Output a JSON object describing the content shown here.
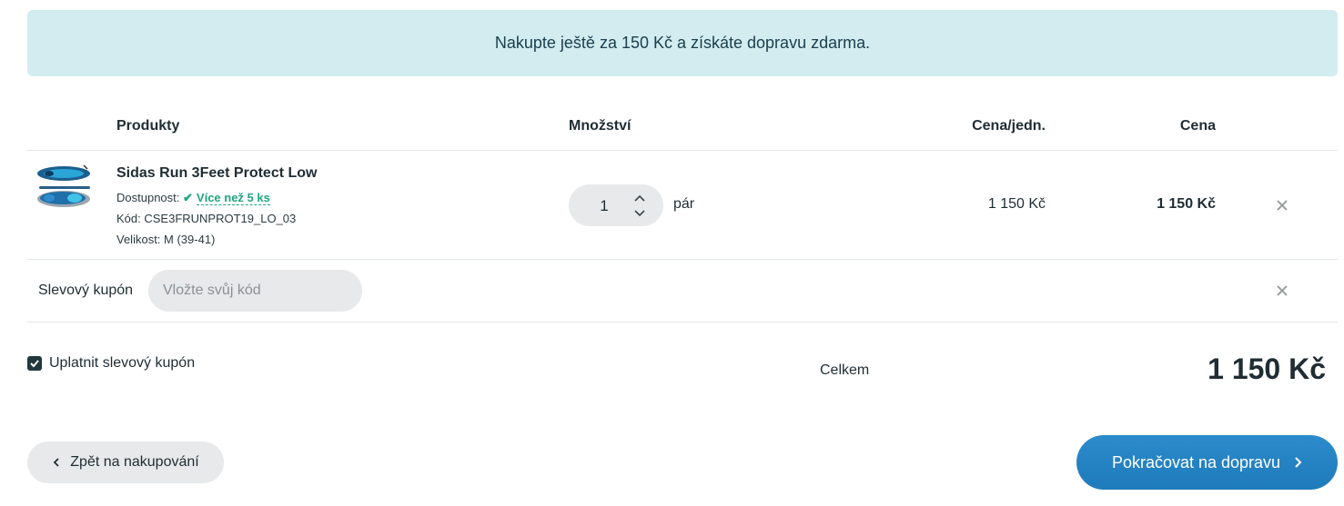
{
  "banner": {
    "text": "Nakupte ještě za 150 Kč a získáte dopravu zdarma."
  },
  "table": {
    "headers": {
      "products": "Produkty",
      "quantity": "Množství",
      "unit_price": "Cena/jedn.",
      "price": "Cena"
    },
    "rows": [
      {
        "name": "Sidas Run 3Feet Protect Low",
        "availability_label": "Dostupnost:",
        "availability_value": "Více než 5 ks",
        "code": "Kód: CSE3FRUNPROT19_LO_03",
        "size": "Velikost: M (39-41)",
        "quantity": "1",
        "unit": "pár",
        "unit_price": "1 150 Kč",
        "price": "1 150 Kč",
        "thumbnail_icon": "insole-thumbnail"
      }
    ]
  },
  "coupon": {
    "label": "Slevový kupón",
    "placeholder": "Vložte svůj kód",
    "apply_label": "Uplatnit slevový kupón",
    "apply_checked": true
  },
  "summary": {
    "total_label": "Celkem",
    "total_value": "1 150 Kč"
  },
  "actions": {
    "back_label": "Zpět na nakupování",
    "continue_label": "Pokračovat na dopravu"
  },
  "colors": {
    "banner_bg": "#d3ecef",
    "accent_green": "#1fa67f",
    "primary_blue": "#1f7bbb",
    "pill_gray": "#e7e9ea"
  }
}
